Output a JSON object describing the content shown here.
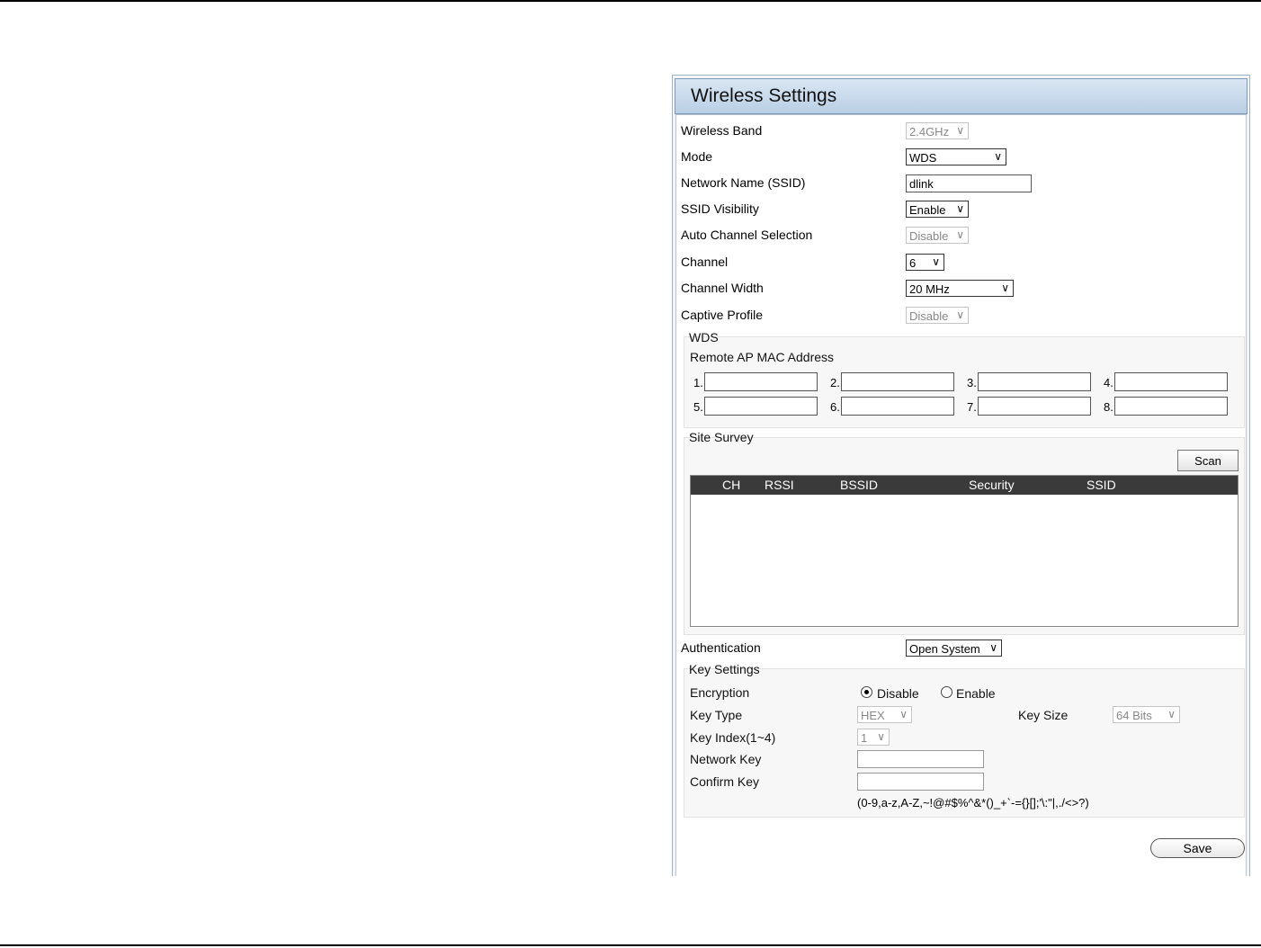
{
  "panel": {
    "title": "Wireless Settings"
  },
  "fields": {
    "wireless_band": {
      "label": "Wireless Band",
      "value": "2.4GHz"
    },
    "mode": {
      "label": "Mode",
      "value": "WDS"
    },
    "ssid": {
      "label": "Network Name (SSID)",
      "value": "dlink"
    },
    "ssid_visibility": {
      "label": "SSID Visibility",
      "value": "Enable"
    },
    "auto_channel": {
      "label": "Auto Channel Selection",
      "value": "Disable"
    },
    "channel": {
      "label": "Channel",
      "value": "6"
    },
    "channel_width": {
      "label": "Channel Width",
      "value": "20 MHz"
    },
    "captive_profile": {
      "label": "Captive Profile",
      "value": "Disable"
    }
  },
  "wds": {
    "legend": "WDS",
    "remote_label": "Remote AP MAC Address",
    "slots": [
      "1.",
      "2.",
      "3.",
      "4.",
      "5.",
      "6.",
      "7.",
      "8."
    ]
  },
  "site_survey": {
    "legend": "Site Survey",
    "scan_label": "Scan",
    "columns": [
      "CH",
      "RSSI",
      "BSSID",
      "Security",
      "SSID"
    ]
  },
  "authentication": {
    "label": "Authentication",
    "value": "Open System"
  },
  "key_settings": {
    "legend": "Key Settings",
    "encryption_label": "Encryption",
    "encryption_options": [
      "Disable",
      "Enable"
    ],
    "encryption_selected": "Disable",
    "key_type_label": "Key Type",
    "key_type_value": "HEX",
    "key_size_label": "Key Size",
    "key_size_value": "64 Bits",
    "key_index_label": "Key Index(1~4)",
    "key_index_value": "1",
    "network_key_label": "Network Key",
    "confirm_key_label": "Confirm Key",
    "allowed_chars": "(0-9,a-z,A-Z,~!@#$%^&*()_+`-={}[];'\\:\"|,./<>?)"
  },
  "save_label": "Save"
}
